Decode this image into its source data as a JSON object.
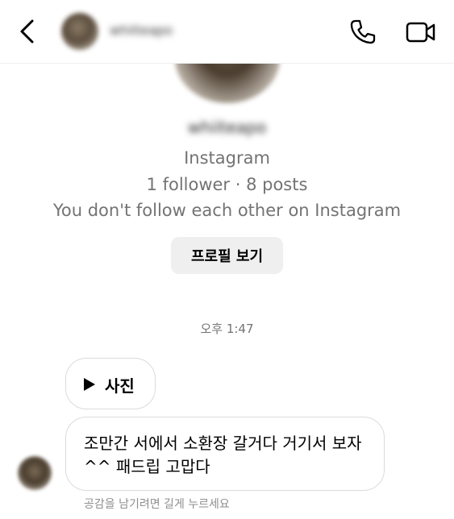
{
  "header": {
    "contact_name": "whiiteapo",
    "back_icon": "chevron-left-icon",
    "call_icon": "phone-icon",
    "video_icon": "video-camera-icon"
  },
  "profile": {
    "username": "whiiteapo",
    "platform": "Instagram",
    "stats": "1 follower · 8 posts",
    "relation": "You don't follow each other on Instagram",
    "view_profile_label": "프로필 보기"
  },
  "conversation": {
    "timestamp": "오후 1:47",
    "messages": [
      {
        "type": "media",
        "icon": "play-icon",
        "label": "사진"
      },
      {
        "type": "text",
        "text": "조만간 서에서 소환장 갈거다 거기서 보자 ^^ 패드립 고맙다"
      }
    ],
    "reaction_hint": "공감을 남기려면 길게 누르세요"
  },
  "colors": {
    "background": "#ffffff",
    "secondary_text": "#737373",
    "button_background": "#efefef",
    "bubble_border": "#dbdbdb"
  }
}
